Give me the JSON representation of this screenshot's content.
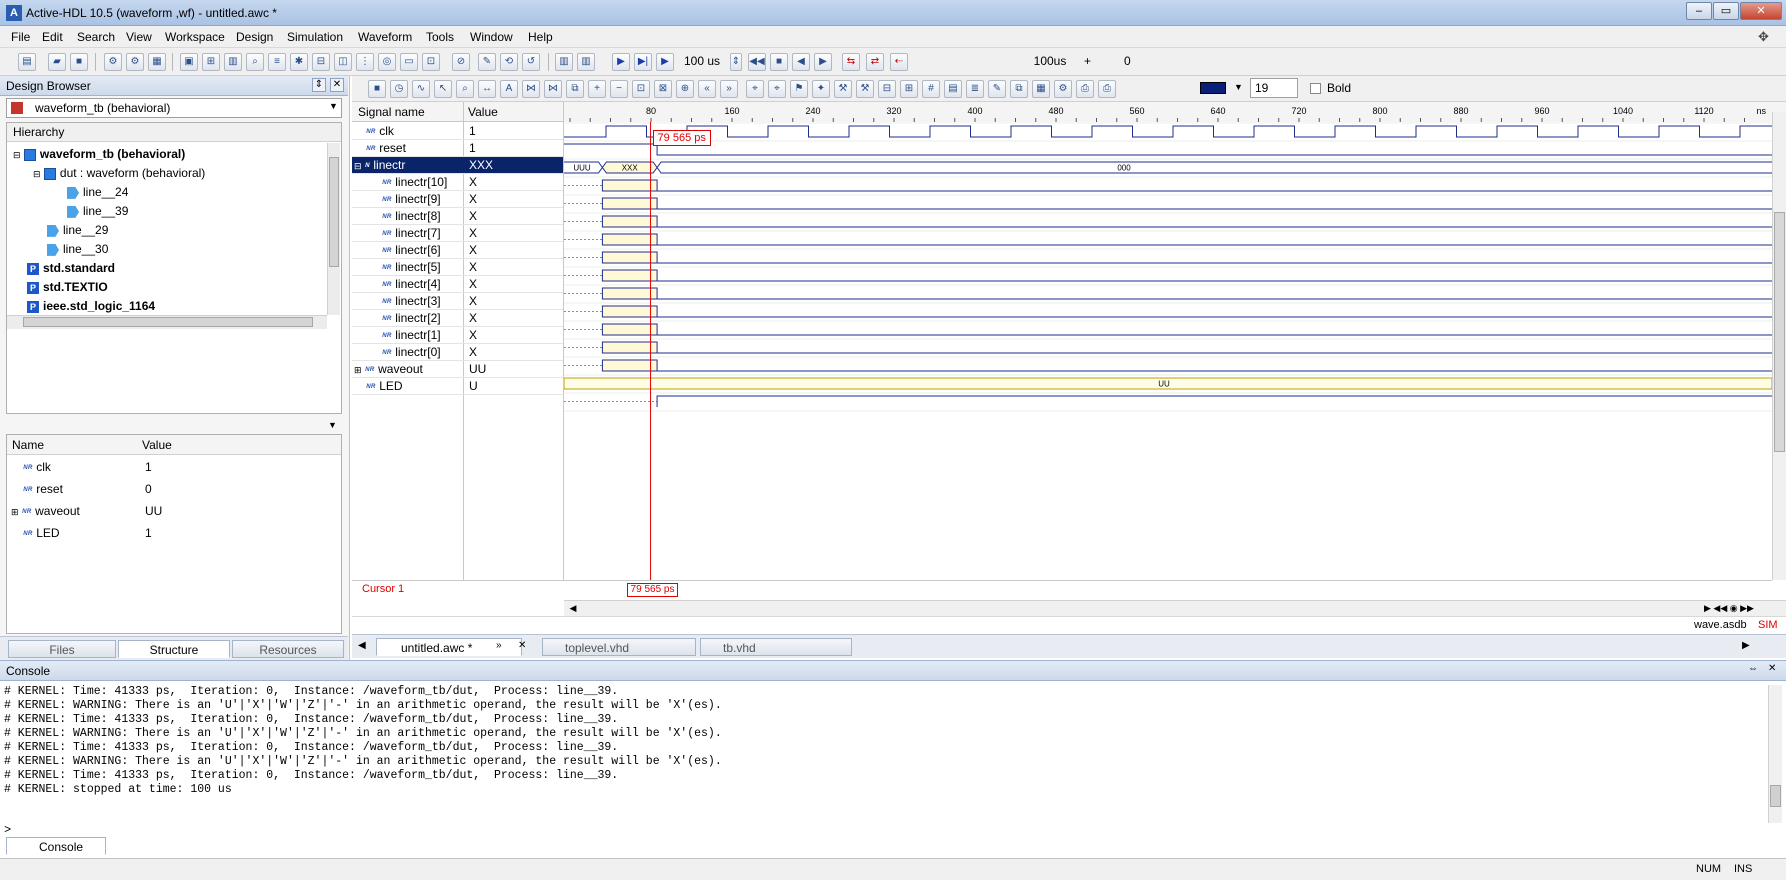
{
  "window": {
    "title": "Active-HDL 10.5 (waveform ,wf) - untitled.awc *",
    "app_icon": "A",
    "min_label": "–",
    "max_label": "▭",
    "close_label": "✕"
  },
  "menu": [
    "File",
    "Edit",
    "Search",
    "View",
    "Workspace",
    "Design",
    "Simulation",
    "Waveform",
    "Tools",
    "Window",
    "Help"
  ],
  "toolbar": {
    "run_time": "100 us",
    "sim_time": "100us",
    "plus": "+",
    "delta": "0",
    "font_size": "19",
    "bold_label": "Bold"
  },
  "design_browser": {
    "title": "Design Browser",
    "selected": "waveform_tb (behavioral)",
    "hierarchy_header": "Hierarchy",
    "tree": [
      {
        "label": "waveform_tb (behavioral)",
        "icon": "entity-icon",
        "bold": true
      },
      {
        "label": "dut : waveform (behavioral)",
        "icon": "entity-icon",
        "bold": false
      },
      {
        "label": "line__24",
        "icon": "process-icon",
        "bold": false
      },
      {
        "label": "line__39",
        "icon": "process-icon",
        "bold": false
      },
      {
        "label": "line__29",
        "icon": "process-icon",
        "bold": false
      },
      {
        "label": "line__30",
        "icon": "process-icon",
        "bold": false
      },
      {
        "label": "std.standard",
        "icon": "package-icon",
        "bold": true
      },
      {
        "label": "std.TEXTIO",
        "icon": "package-icon",
        "bold": true
      },
      {
        "label": "ieee.std_logic_1164",
        "icon": "package-icon",
        "bold": true
      }
    ],
    "obj_headers": {
      "name": "Name",
      "value": "Value"
    },
    "objects": [
      {
        "name": "clk",
        "value": "1"
      },
      {
        "name": "reset",
        "value": "0"
      },
      {
        "name": "waveout",
        "value": "UU"
      },
      {
        "name": "LED",
        "value": "1"
      }
    ],
    "tabs": [
      "Files",
      "Structure",
      "Resources"
    ]
  },
  "waveform": {
    "headers": {
      "signal": "Signal name",
      "value": "Value"
    },
    "signals": [
      {
        "name": "clk",
        "value": "1"
      },
      {
        "name": "reset",
        "value": "1"
      },
      {
        "name": "linectr",
        "value": "XXX"
      },
      {
        "name": "linectr[10]",
        "value": "X"
      },
      {
        "name": "linectr[9]",
        "value": "X"
      },
      {
        "name": "linectr[8]",
        "value": "X"
      },
      {
        "name": "linectr[7]",
        "value": "X"
      },
      {
        "name": "linectr[6]",
        "value": "X"
      },
      {
        "name": "linectr[5]",
        "value": "X"
      },
      {
        "name": "linectr[4]",
        "value": "X"
      },
      {
        "name": "linectr[3]",
        "value": "X"
      },
      {
        "name": "linectr[2]",
        "value": "X"
      },
      {
        "name": "linectr[1]",
        "value": "X"
      },
      {
        "name": "linectr[0]",
        "value": "X"
      },
      {
        "name": "waveout",
        "value": "UU"
      },
      {
        "name": "LED",
        "value": "U"
      }
    ],
    "ruler_ticks": [
      "80",
      "160",
      "240",
      "320",
      "400",
      "480",
      "560",
      "640",
      "720",
      "800",
      "880",
      "960",
      "1040",
      "1120"
    ],
    "ruler_unit": "ns",
    "cursor_time": "79 565 ps",
    "cursor_label": "Cursor 1",
    "bus_labels": {
      "uuu": "UUU",
      "xxx": "XXX",
      "ooo": "000",
      "uu": "UU"
    },
    "file_label": "wave.asdb",
    "sim_label": "SIM",
    "doc_tabs": [
      "untitled.awc *",
      "toplevel.vhd",
      "tb.vhd"
    ]
  },
  "console": {
    "title": "Console",
    "lines": [
      "# KERNEL: Time: 41333 ps,  Iteration: 0,  Instance: /waveform_tb/dut,  Process: line__39.",
      "# KERNEL: WARNING: There is an 'U'|'X'|'W'|'Z'|'-' in an arithmetic operand, the result will be 'X'(es).",
      "# KERNEL: Time: 41333 ps,  Iteration: 0,  Instance: /waveform_tb/dut,  Process: line__39.",
      "# KERNEL: WARNING: There is an 'U'|'X'|'W'|'Z'|'-' in an arithmetic operand, the result will be 'X'(es).",
      "# KERNEL: Time: 41333 ps,  Iteration: 0,  Instance: /waveform_tb/dut,  Process: line__39.",
      "# KERNEL: WARNING: There is an 'U'|'X'|'W'|'Z'|'-' in an arithmetic operand, the result will be 'X'(es).",
      "# KERNEL: Time: 41333 ps,  Iteration: 0,  Instance: /waveform_tb/dut,  Process: line__39.",
      "# KERNEL: stopped at time: 100 us"
    ],
    "prompt": ">",
    "tab": "Console"
  },
  "status": {
    "num": "NUM",
    "ins": "INS"
  },
  "colors": {
    "accent": "#0a246a",
    "cursor": "#e00000",
    "wave": "#1e2d8c",
    "unknown": "#fff9d6",
    "bus_u": "#b8a400"
  }
}
